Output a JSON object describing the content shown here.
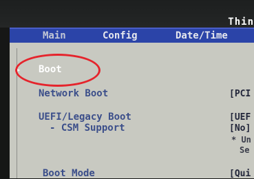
{
  "header": {
    "brand": "Thin"
  },
  "tabs": [
    {
      "label": "Main"
    },
    {
      "label": "Config"
    },
    {
      "label": "Date/Time"
    }
  ],
  "items": {
    "boot": "Boot",
    "network_boot": "Network Boot",
    "uefi_legacy": "UEFI/Legacy Boot",
    "csm": "- CSM Support",
    "boot_mode": "Boot Mode"
  },
  "values": {
    "network_boot": "[PCI",
    "uefi_legacy": "[UEF",
    "csm": "[No]",
    "note1": "* Un",
    "note2": "Se",
    "boot_mode": "[Qui"
  }
}
